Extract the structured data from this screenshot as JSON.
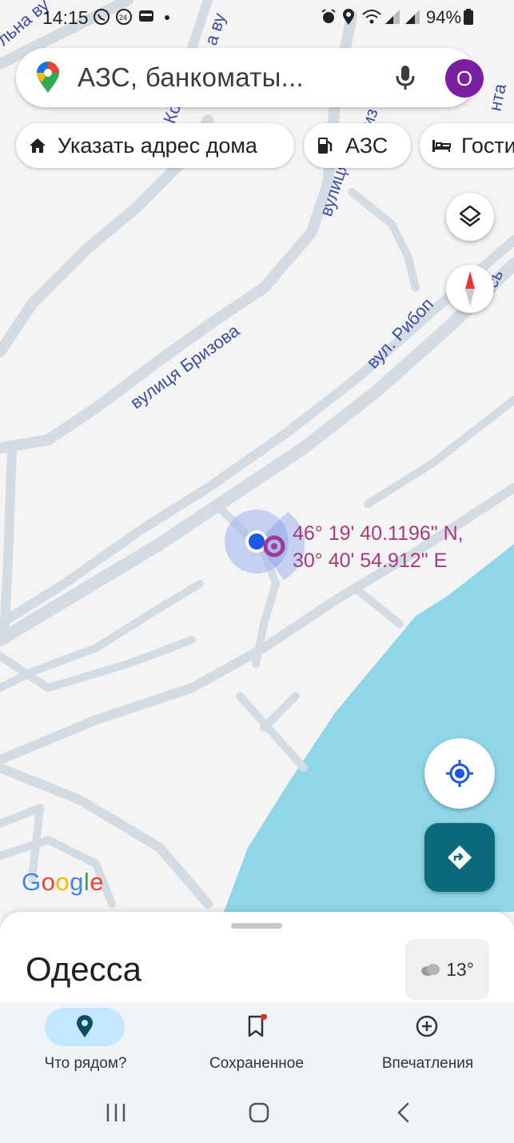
{
  "status_bar": {
    "time": "14:15",
    "battery": "94%",
    "icons": [
      "viber-icon",
      "24-badge-icon",
      "wallet-icon",
      "dot-icon",
      "alarm-icon",
      "location-icon",
      "wifi-icon",
      "signal-icon",
      "signal-icon",
      "battery-icon"
    ]
  },
  "search": {
    "placeholder": "АЗС, банкоматы...",
    "avatar_letter": "O",
    "avatar_color": "#7b1fa2"
  },
  "chips": [
    {
      "label": "Указать адрес дома",
      "icon": "home-icon"
    },
    {
      "label": "АЗС",
      "icon": "gas-station-icon"
    },
    {
      "label": "Гости",
      "icon": "hotel-bed-icon"
    }
  ],
  "map": {
    "streets": {
      "brizova": "вулиця Бризова",
      "rybopromyslova": "вул. Рибоп",
      "tail_vsy": "всь",
      "top_left_1": "льна ву",
      "top_left_2": "Ко",
      "top_left_3": "вулиця",
      "top_right": "нта",
      "vertical_a": "а ву",
      "vertical_b": "из"
    },
    "coordinates": {
      "lat": "46° 19' 40.1196\" N,",
      "lon": "30° 40' 54.912\" E"
    },
    "water_color": "#8fd7e8",
    "logo": "Google"
  },
  "sheet": {
    "city": "Одесса",
    "temperature": "13°"
  },
  "tabs": [
    {
      "label": "Что рядом?",
      "icon": "place-pin-icon",
      "active": true
    },
    {
      "label": "Сохраненное",
      "icon": "bookmark-icon",
      "active": false
    },
    {
      "label": "Впечатления",
      "icon": "add-circle-icon",
      "active": false
    }
  ],
  "colors": {
    "accent_teal": "#0b6b7a",
    "location_blue": "#1a56e8",
    "coords_text": "#a73b7c"
  }
}
